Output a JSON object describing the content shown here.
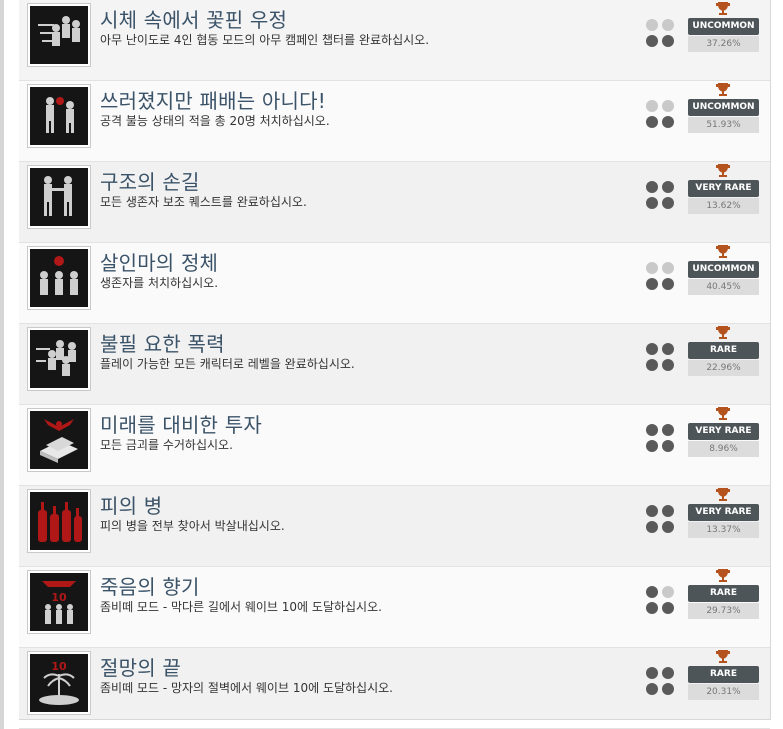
{
  "achievements": [
    {
      "title": "시체 속에서 꽃핀 우정",
      "description": "아무 난이도로 4인 협동 모드의 아무 캠페인 챕터를 완료하십시오.",
      "difficulty_dots": [
        false,
        false,
        true,
        true
      ],
      "rarity": "UNCOMMON",
      "percent": "37.26%",
      "icon": "soldiers-firing-icon"
    },
    {
      "title": "쓰러졌지만 패배는 아니다!",
      "description": "공격 불능 상태의 적을 총 20명 처치하십시오.",
      "difficulty_dots": [
        false,
        false,
        true,
        true
      ],
      "rarity": "UNCOMMON",
      "percent": "51.93%",
      "icon": "soldiers-fighting-icon"
    },
    {
      "title": "구조의 손길",
      "description": "모든 생존자 보조 퀘스트를 완료하십시오.",
      "difficulty_dots": [
        true,
        true,
        true,
        true
      ],
      "rarity": "VERY RARE",
      "percent": "13.62%",
      "icon": "soldiers-helping-icon"
    },
    {
      "title": "살인마의 정체",
      "description": "생존자를 처치하십시오.",
      "difficulty_dots": [
        false,
        false,
        true,
        true
      ],
      "rarity": "UNCOMMON",
      "percent": "40.45%",
      "icon": "soldiers-killer-icon"
    },
    {
      "title": "불필 요한 폭력",
      "description": "플레이 가능한 모든 캐릭터로 레벨을 완료하십시오.",
      "difficulty_dots": [
        true,
        true,
        true,
        true
      ],
      "rarity": "RARE",
      "percent": "22.96%",
      "icon": "soldiers-squad-icon"
    },
    {
      "title": "미래를 대비한 투자",
      "description": "모든 금괴를 수거하십시오.",
      "difficulty_dots": [
        true,
        true,
        true,
        true
      ],
      "rarity": "VERY RARE",
      "percent": "8.96%",
      "icon": "gold-bars-icon"
    },
    {
      "title": "피의 병",
      "description": "피의 병을 전부 찾아서 박살내십시오.",
      "difficulty_dots": [
        true,
        true,
        true,
        true
      ],
      "rarity": "VERY RARE",
      "percent": "13.37%",
      "icon": "blood-bottles-icon"
    },
    {
      "title": "죽음의 향기",
      "description": "좀비떼 모드 - 막다른 길에서 웨이브 10에 도달하십시오.",
      "difficulty_dots": [
        true,
        false,
        true,
        true
      ],
      "rarity": "RARE",
      "percent": "29.73%",
      "icon": "zombie-wave-icon"
    },
    {
      "title": "절망의 끝",
      "description": "좀비떼 모드 - 망자의 절벽에서 웨이브 10에 도달하십시오.",
      "difficulty_dots": [
        true,
        true,
        true,
        true
      ],
      "rarity": "RARE",
      "percent": "20.31%",
      "icon": "island-wave-icon"
    }
  ],
  "icon_thumbs": {
    "1": "10",
    "2": "10"
  },
  "colors": {
    "title": "#3b5368",
    "rarity_bg": "#4e5559",
    "trophy": "#b5531f",
    "thumb_red": "#b01818"
  }
}
